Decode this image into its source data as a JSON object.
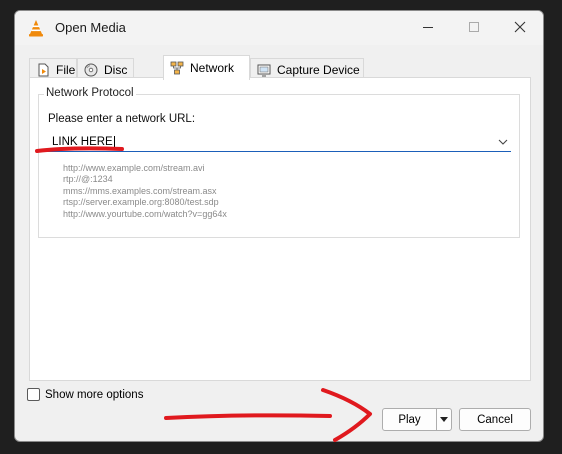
{
  "window": {
    "title": "Open Media"
  },
  "tabs": [
    {
      "label": "File",
      "icon": "file-icon",
      "active": false
    },
    {
      "label": "Disc",
      "icon": "disc-icon",
      "active": false
    },
    {
      "label": "Network",
      "icon": "network-icon",
      "active": true
    },
    {
      "label": "Capture Device",
      "icon": "capture-device-icon",
      "active": false
    }
  ],
  "network": {
    "group_title": "Network Protocol",
    "url_label": "Please enter a network URL:",
    "url_value": "LINK HERE",
    "examples": [
      "http://www.example.com/stream.avi",
      "rtp://@:1234",
      "mms://mms.examples.com/stream.asx",
      "rtsp://server.example.org:8080/test.sdp",
      "http://www.yourtube.com/watch?v=gg64x"
    ]
  },
  "options": {
    "show_more_label": "Show more options",
    "show_more_checked": false
  },
  "buttons": {
    "play": "Play",
    "cancel": "Cancel"
  },
  "colors": {
    "annotation_red": "#e0191e",
    "focus_blue": "#1b5fb9",
    "vlc_orange": "#f08a0c"
  }
}
